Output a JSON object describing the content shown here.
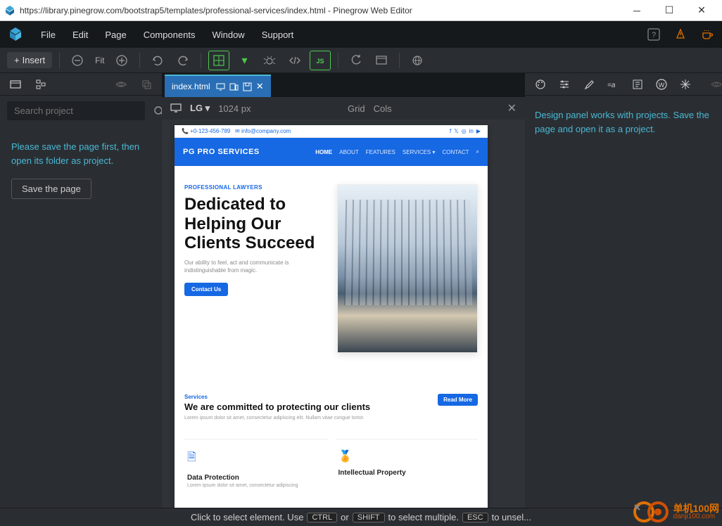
{
  "titlebar": {
    "url": "https://library.pinegrow.com/bootstrap5/templates/professional-services/index.html - Pinegrow Web Editor"
  },
  "menu": {
    "file": "File",
    "edit": "Edit",
    "page": "Page",
    "components": "Components",
    "window": "Window",
    "support": "Support"
  },
  "toolbar": {
    "insert": "Insert",
    "fit": "Fit"
  },
  "left": {
    "search_placeholder": "Search project",
    "message": "Please save the page first, then open its folder as project.",
    "save_btn": "Save the page"
  },
  "tab": {
    "name": "index.html"
  },
  "canvas_header": {
    "breakpoint": "LG",
    "width": "1024 px",
    "grid": "Grid",
    "cols": "Cols"
  },
  "site": {
    "phone": "+0-123-456-789",
    "email": "info@company.com",
    "brand": "PG PRO SERVICES",
    "nav": {
      "home": "HOME",
      "about": "ABOUT",
      "features": "FEATURES",
      "services": "SERVICES",
      "contact": "CONTACT"
    },
    "hero": {
      "eyebrow": "PROFESSIONAL LAWYERS",
      "title_l1": "Dedicated to",
      "title_l2": "Helping Our",
      "title_l3": "Clients Succeed",
      "sub": "Our ability to feel, act and communicate is indistinguishable from magic.",
      "btn": "Contact Us"
    },
    "services": {
      "eyebrow": "Services",
      "title": "We are committed to protecting our clients",
      "sub": "Lorem ipsum dolor sit amet, consectetur adipiscing elit. Nullam vitae congue tortor.",
      "readmore": "Read More",
      "card1": {
        "title": "Data Protection",
        "sub": "Lorem ipsum dolor sit amet, consectetur adipiscing"
      },
      "card2": {
        "title": "Intellectual Property"
      }
    }
  },
  "right": {
    "message": "Design panel works with projects. Save the page and open it as a project."
  },
  "status": {
    "p1": "Click to select element. Use",
    "k1": "CTRL",
    "or": "or",
    "k2": "SHIFT",
    "p2": "to select multiple.",
    "k3": "ESC",
    "p3": "to unsel..."
  },
  "watermark": {
    "t1": "单机100网",
    "t2": "danji100.com"
  }
}
